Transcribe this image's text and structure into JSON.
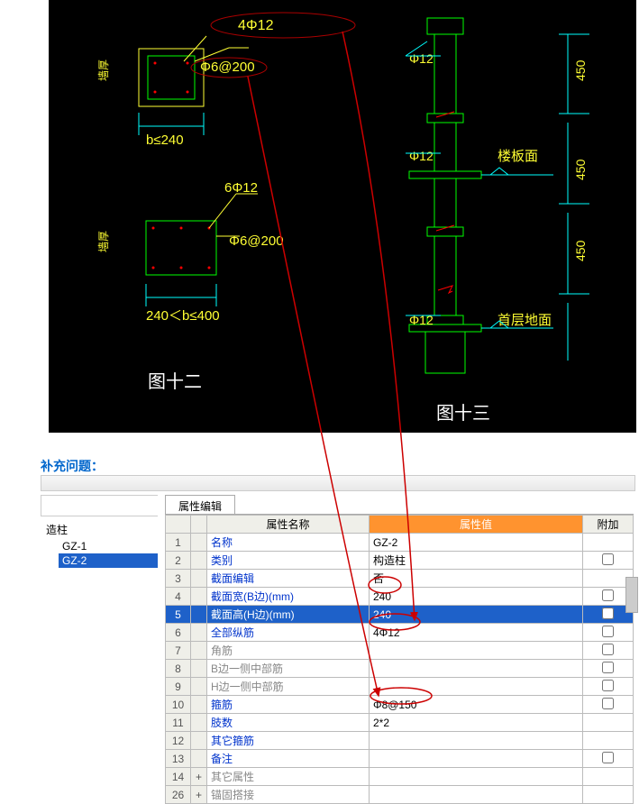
{
  "question_label": "补充问题：",
  "cad": {
    "top_annot": "4Φ12",
    "stirrup1": "Φ6@200",
    "cond1": "b≤240",
    "rebar2": "6Φ12",
    "stirrup2": "Φ6@200",
    "cond2": "240＜b≤400",
    "fig1": "图十二",
    "fig2": "图十三",
    "phi1": "Φ12",
    "phi2": "Φ12",
    "phi3": "Φ12",
    "dim450a": "450",
    "dim450b": "450",
    "dim450c": "450",
    "floor": "楼板面",
    "ground": "首层地面",
    "wall_thk1": "墙厚",
    "wall_thk2": "墙厚"
  },
  "search": {
    "placeholder": ""
  },
  "tree": {
    "root": "造柱",
    "children": [
      "GZ-1",
      "GZ-2"
    ]
  },
  "tab": "属性编辑",
  "headers": {
    "name": "属性名称",
    "value": "属性值",
    "extra": "附加"
  },
  "rows": [
    {
      "n": "1",
      "name": "名称",
      "link": true,
      "val": "GZ-2",
      "chk": null
    },
    {
      "n": "2",
      "name": "类别",
      "link": true,
      "val": "构造柱",
      "chk": false
    },
    {
      "n": "3",
      "name": "截面编辑",
      "link": true,
      "val": "否",
      "chk": null
    },
    {
      "n": "4",
      "name": "截面宽(B边)(mm)",
      "link": true,
      "val": "240",
      "chk": false
    },
    {
      "n": "5",
      "name": "截面高(H边)(mm)",
      "link": true,
      "val": "240",
      "chk": false,
      "sel": true
    },
    {
      "n": "6",
      "name": "全部纵筋",
      "link": true,
      "val": "4Φ12",
      "chk": false
    },
    {
      "n": "7",
      "name": "角筋",
      "gray": true,
      "val": "",
      "chk": false
    },
    {
      "n": "8",
      "name": "B边一侧中部筋",
      "gray": true,
      "val": "",
      "chk": false
    },
    {
      "n": "9",
      "name": "H边一侧中部筋",
      "gray": true,
      "val": "",
      "chk": false
    },
    {
      "n": "10",
      "name": "箍筋",
      "link": true,
      "val": "Φ8@150",
      "chk": false
    },
    {
      "n": "11",
      "name": "肢数",
      "link": true,
      "val": "2*2",
      "chk": null
    },
    {
      "n": "12",
      "name": "其它箍筋",
      "link": true,
      "val": "",
      "chk": null
    },
    {
      "n": "13",
      "name": "备注",
      "link": true,
      "val": "",
      "chk": false
    },
    {
      "n": "14",
      "name": "其它属性",
      "gray": true,
      "val": "",
      "chk": null,
      "plus": "+"
    },
    {
      "n": "26",
      "name": "锚固搭接",
      "gray": true,
      "val": "",
      "chk": null,
      "plus": "+"
    }
  ]
}
